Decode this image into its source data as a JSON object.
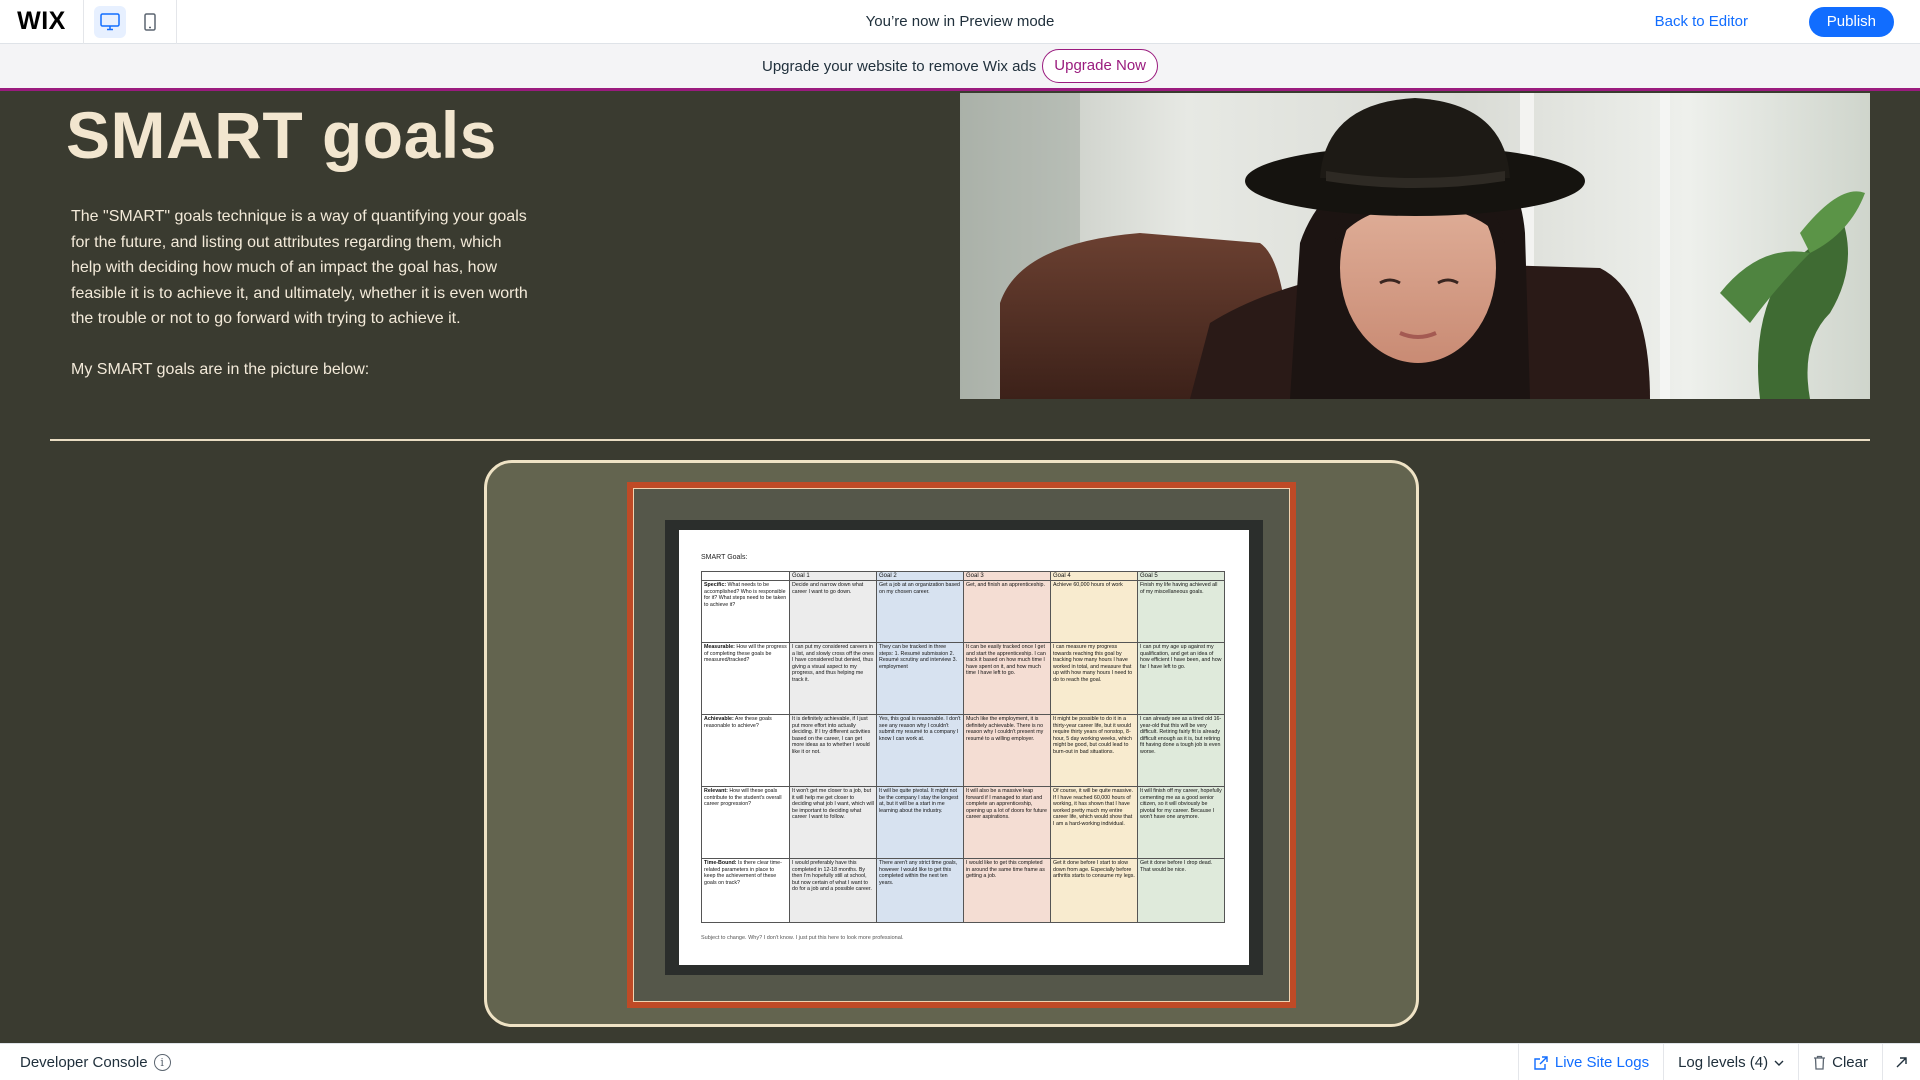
{
  "topbar": {
    "logo": "WIX",
    "preview_text": "You’re now in Preview mode",
    "back_to_editor": "Back to Editor",
    "publish": "Publish",
    "accent": "#116dff"
  },
  "banner": {
    "text": "Upgrade your website to remove Wix ads",
    "button": "Upgrade Now",
    "accent": "#9a1b7e"
  },
  "page": {
    "title": "SMART goals",
    "intro": "The \"SMART\" goals technique is a way of quantifying your goals for the future, and listing out attributes regarding them, which help with deciding how much of an impact the goal has, how feasible it is to achieve it, and ultimately, whether it is even worth the trouble or not to go forward with trying to achieve it.",
    "intro2": "My SMART goals are in the picture below:",
    "doc": {
      "title": "SMART Goals:",
      "headers": [
        "",
        "Goal 1",
        "Goal 2",
        "Goal 3",
        "Goal 4",
        "Goal 5"
      ],
      "rows": [
        {
          "head_bold": "Specific:",
          "head_rest": " What needs to be accomplished? Who is responsible for it? What steps need to be taken to achieve it?",
          "cells": [
            "Decide and narrow down what career I want to go down.",
            "Get a job at an organization based on my chosen career.",
            "Get, and finish an apprenticeship.",
            "Achieve 60,000 hours of work",
            "Finish my life having achieved all of my miscellaneous goals."
          ]
        },
        {
          "head_bold": "Measurable:",
          "head_rest": " How will the progress of completing these goals be measured/tracked?",
          "cells": [
            "I can put my considered careers in a list, and slowly cross off the ones I have considered but denied, thus giving a visual aspect to my progress, and thus helping me track it.",
            "They can be tracked in three steps: 1. Resumé submission 2. Resumé scrutiny and interview 3. employment",
            "It can be easily tracked once I get and start the apprenticeship. I can track it based on how much time I have spent on it, and how much time I have left to go.",
            "I can measure my progress towards reaching this goal by tracking how many hours I have worked in total, and measure that up with how many hours I need to do to reach the goal.",
            "I can put my age up against my qualification, and get an idea of how efficient I have been, and how far I have left to go."
          ]
        },
        {
          "head_bold": "Achievable:",
          "head_rest": " Are these goals reasonable to achieve?",
          "cells": [
            "It is definitely achievable, if I just put more effort into actually deciding. If I try different activities based on the career, I can get more ideas as to whether I would like it or not.",
            "Yes, this goal is reasonable. I don't see any reason why I couldn't submit my resumé to a company I know I can work at.",
            "Much like the employment, it is definitely achievable. There is no reason why I couldn't present my resumé to a willing employer.",
            "It might be possible to do it in a thirty-year career life, but it would require thirty years of nonstop, 8-hour, 5 day working weeks, which might be good, but could lead to burn-out in bad situations.",
            "I can already see as a tired old 16-year-old that this will be very difficult. Retiring fairly fit is already difficult enough as it is, but retiring fit having done a tough job is even worse."
          ]
        },
        {
          "head_bold": "Relevant:",
          "head_rest": " How will these goals contribute to the student's overall career progression?",
          "cells": [
            "It won't get me closer to a job, but it will help me get closer to deciding what job I want, which will be important to deciding what career I want to follow.",
            "It will be quite pivotal. It might not be the company I stay the longest at, but it will be a start in me learning about the industry.",
            "It will also be a massive leap forward if I managed to start and complete an apprenticeship, opening up a lot of doors for future career aspirations.",
            "Of course, it will be quite massive. If I have reached 60,000 hours of working, it has shown that I have worked pretty much my entire career life, which would show that I am a hard-working individual.",
            "It will finish off my career, hopefully cementing me as a good senior citizen, so it will obviously be pivotal for my career. Because I won't have one anymore."
          ]
        },
        {
          "head_bold": "Time-Bound:",
          "head_rest": " Is there clear time-related parameters in place to keep the achievement of these goals on track?",
          "cells": [
            "I would preferably have this completed in 12-18 months. By then I'm hopefully still at school, but now certain of what I want to do for a job and a possible career.",
            "There aren't any strict time goals, however I would like to get this completed within the next ten years.",
            "I would like to get this completed in around the same time frame as getting a job.",
            "Get it done before I start to slow down from age. Especially before arthritis starts to consume my legs.",
            "Get it done before I drop dead. That would be nice."
          ]
        }
      ],
      "footnote": "Subject to change. Why? I don't know. I just put this here to look more professional."
    }
  },
  "console": {
    "title": "Developer Console",
    "info_icon": "info-icon",
    "live_logs": "Live Site Logs",
    "log_levels": "Log levels (4)",
    "clear": "Clear"
  }
}
